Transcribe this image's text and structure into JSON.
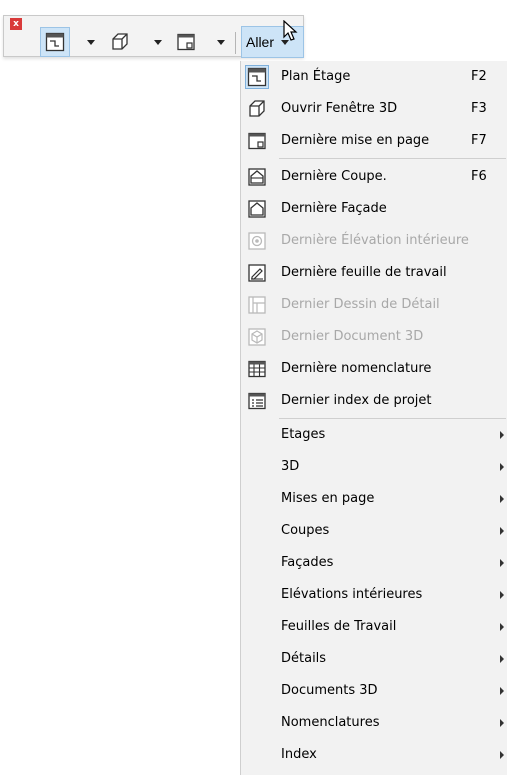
{
  "toolbar": {
    "close_glyph": "x",
    "aller_label": "Aller"
  },
  "menu": {
    "items": [
      {
        "label": "Plan Étage",
        "shortcut": "F2",
        "icon": "floor-plan-icon"
      },
      {
        "label": "Ouvrir Fenêtre 3D",
        "shortcut": "F3",
        "icon": "3d-window-icon"
      },
      {
        "label": "Dernière mise en page",
        "shortcut": "F7",
        "icon": "layout-icon"
      },
      {
        "label": "Dernière Coupe.",
        "shortcut": "F6",
        "icon": "section-icon"
      },
      {
        "label": "Dernière Façade",
        "shortcut": "",
        "icon": "elevation-icon"
      },
      {
        "label": "Dernière Élévation intérieure",
        "shortcut": "",
        "icon": "interior-elevation-icon"
      },
      {
        "label": "Dernière feuille de travail",
        "shortcut": "",
        "icon": "worksheet-icon"
      },
      {
        "label": "Dernier Dessin de Détail",
        "shortcut": "",
        "icon": "detail-drawing-icon"
      },
      {
        "label": "Dernier Document 3D",
        "shortcut": "",
        "icon": "3d-document-icon"
      },
      {
        "label": "Dernière nomenclature",
        "shortcut": "",
        "icon": "schedule-icon"
      },
      {
        "label": "Dernier index de projet",
        "shortcut": "",
        "icon": "project-index-icon"
      }
    ],
    "submenus": [
      "Etages",
      "3D",
      "Mises en page",
      "Coupes",
      "Façades",
      "Elévations intérieures",
      "Feuilles de Travail",
      "Détails",
      "Documents 3D",
      "Nomenclatures",
      "Index"
    ]
  },
  "colors": {
    "highlight": "#cde4f7",
    "highlight_border": "#9cc4e6",
    "close_red": "#d93a3a",
    "disabled_text": "#a8a8a8"
  }
}
